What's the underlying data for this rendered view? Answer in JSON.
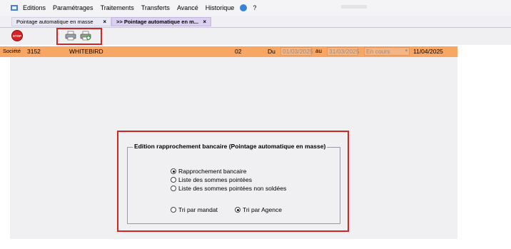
{
  "menu": {
    "items": [
      "Editions",
      "Paramétrages",
      "Traitements",
      "Transferts",
      "Avancé",
      "Historique",
      "?"
    ]
  },
  "tabs": [
    {
      "label": "Pointage automatique en masse",
      "close": "×"
    },
    {
      "label": ">> Pointage automatique en m...",
      "close": "×"
    }
  ],
  "toolbar": {
    "stop_label": "STOP",
    "icons": [
      "stop-icon",
      "printer-icon",
      "printer-add-icon"
    ]
  },
  "company": {
    "label": "Société",
    "number": "3152",
    "name": "WHITEBIRD",
    "code": "02",
    "du_label": "Du",
    "date_from": "01/03/2025",
    "au_label": "au",
    "date_to": "31/03/2025",
    "status": "En cours",
    "date": "11/04/2025"
  },
  "group": {
    "title": "Edition rapprochement bancaire (Pointage automatique en masse)",
    "report_options": [
      {
        "label": "Rapprochement bancaire",
        "checked": true
      },
      {
        "label": "Liste des sommes pointées",
        "checked": false
      },
      {
        "label": "Liste des sommes pointées non soldées",
        "checked": false
      }
    ],
    "sort_options": [
      {
        "label": "Tri par mandat",
        "checked": false
      },
      {
        "label": "Tri par Agence",
        "checked": true
      }
    ]
  },
  "colors": {
    "company_bar": "#f8a664",
    "highlight": "#d42424",
    "active_tab": "#dcd0f0"
  }
}
